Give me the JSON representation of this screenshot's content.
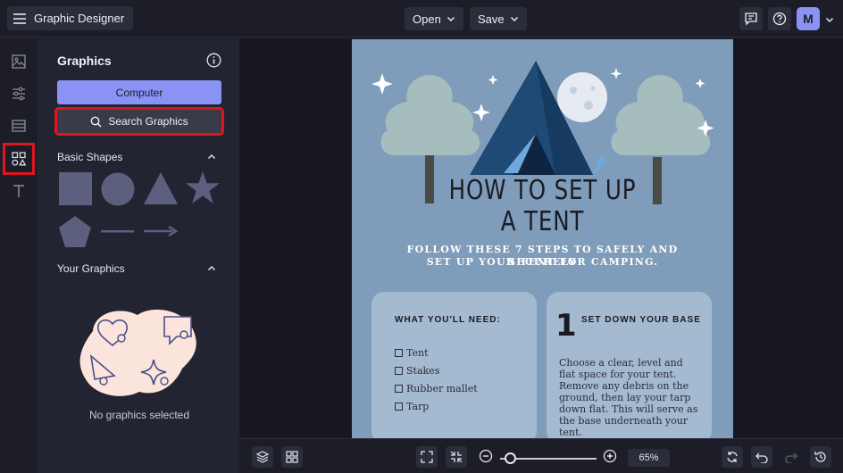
{
  "app": {
    "title": "Graphic Designer",
    "avatar_initial": "M"
  },
  "toolbar": {
    "open_label": "Open",
    "save_label": "Save"
  },
  "rail": {
    "items": [
      {
        "icon": "image-icon",
        "active": false
      },
      {
        "icon": "sliders-icon",
        "active": false
      },
      {
        "icon": "layout-icon",
        "active": false
      },
      {
        "icon": "shapes-icon",
        "active": true
      },
      {
        "icon": "text-icon",
        "active": false
      }
    ]
  },
  "panel": {
    "title": "Graphics",
    "computer_label": "Computer",
    "search_label": "Search Graphics",
    "basic_shapes_label": "Basic Shapes",
    "your_graphics_label": "Your Graphics",
    "empty_text": "No graphics selected",
    "shape_color": "#5c5f7e"
  },
  "poster": {
    "title_line1": "HOW TO SET UP",
    "title_line2": "A TENT",
    "subtitle_line1": "FOLLOW THESE 7 STEPS TO SAFELY AND SECURELY",
    "subtitle_line2": "SET UP YOUR TENT FOR CAMPING.",
    "card1": {
      "heading": "WHAT YOU'LL NEED:",
      "items": [
        "Tent",
        "Stakes",
        "Rubber mallet",
        "Tarp"
      ]
    },
    "card2": {
      "number": "1",
      "heading": "SET DOWN YOUR BASE",
      "text": "Choose a clear, level and flat space for your tent. Remove any debris on the ground, then lay your tarp down flat. This will serve as the base underneath your tent."
    }
  },
  "bottom": {
    "zoom": "65%",
    "zoom_fraction": 0.1
  }
}
